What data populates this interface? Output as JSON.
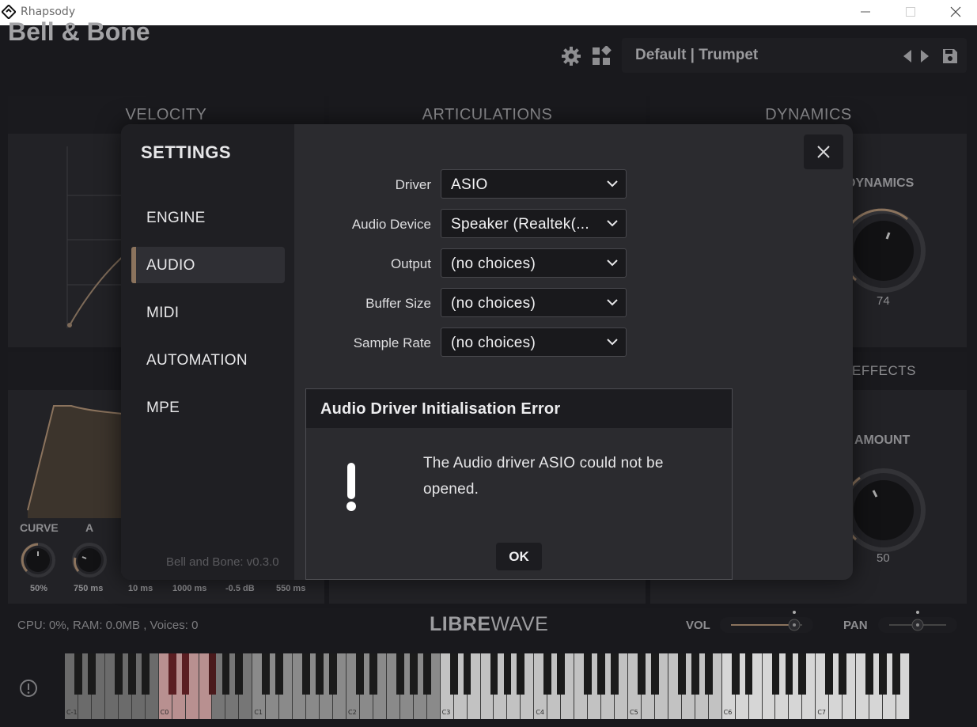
{
  "window": {
    "title": "Rhapsody"
  },
  "header": {
    "brand": "Bell & Bone",
    "preset_name": "Default | Trumpet"
  },
  "panels": {
    "velocity": "VELOCITY",
    "articulations": "ARTICULATIONS",
    "dynamics": "DYNAMICS",
    "effects": "EFFECTS"
  },
  "dynamics_knob": {
    "label": "DYNAMICS",
    "value": "74"
  },
  "amount_knob": {
    "label": "AMOUNT",
    "value": "50"
  },
  "envelope": {
    "curve_label": "CURVE",
    "attack_label": "A",
    "values": [
      "50%",
      "750 ms",
      "10 ms",
      "1000 ms",
      "-0.5 dB",
      "550 ms"
    ]
  },
  "footer": {
    "status": "CPU: 0%, RAM: 0.0MB , Voices: 0",
    "logo_bold": "LIBRE",
    "logo_thin": "WAVE",
    "vol_label": "VOL",
    "pan_label": "PAN"
  },
  "keyboard": {
    "octave_labels": [
      "C-1",
      "C0",
      "C1",
      "C2",
      "C3",
      "C4",
      "C5",
      "C6",
      "C7"
    ],
    "highlight_color": "#b89090"
  },
  "settings": {
    "title": "SETTINGS",
    "nav": [
      "ENGINE",
      "AUDIO",
      "MIDI",
      "AUTOMATION",
      "MPE"
    ],
    "active_nav": "AUDIO",
    "version": "Bell and Bone: v0.3.0",
    "fields": [
      {
        "label": "Driver",
        "value": "ASIO"
      },
      {
        "label": "Audio Device",
        "value": "Speaker (Realtek(..."
      },
      {
        "label": "Output",
        "value": "(no choices)"
      },
      {
        "label": "Buffer Size",
        "value": "(no choices)"
      },
      {
        "label": "Sample Rate",
        "value": "(no choices)"
      }
    ]
  },
  "error_dialog": {
    "title": "Audio Driver Initialisation Error",
    "message": "The Audio driver ASIO could not be opened.",
    "ok_label": "OK"
  },
  "colors": {
    "accent": "#8b735d",
    "background": "#19191d",
    "panel": "#222226",
    "modal": "#2b2b2f"
  }
}
